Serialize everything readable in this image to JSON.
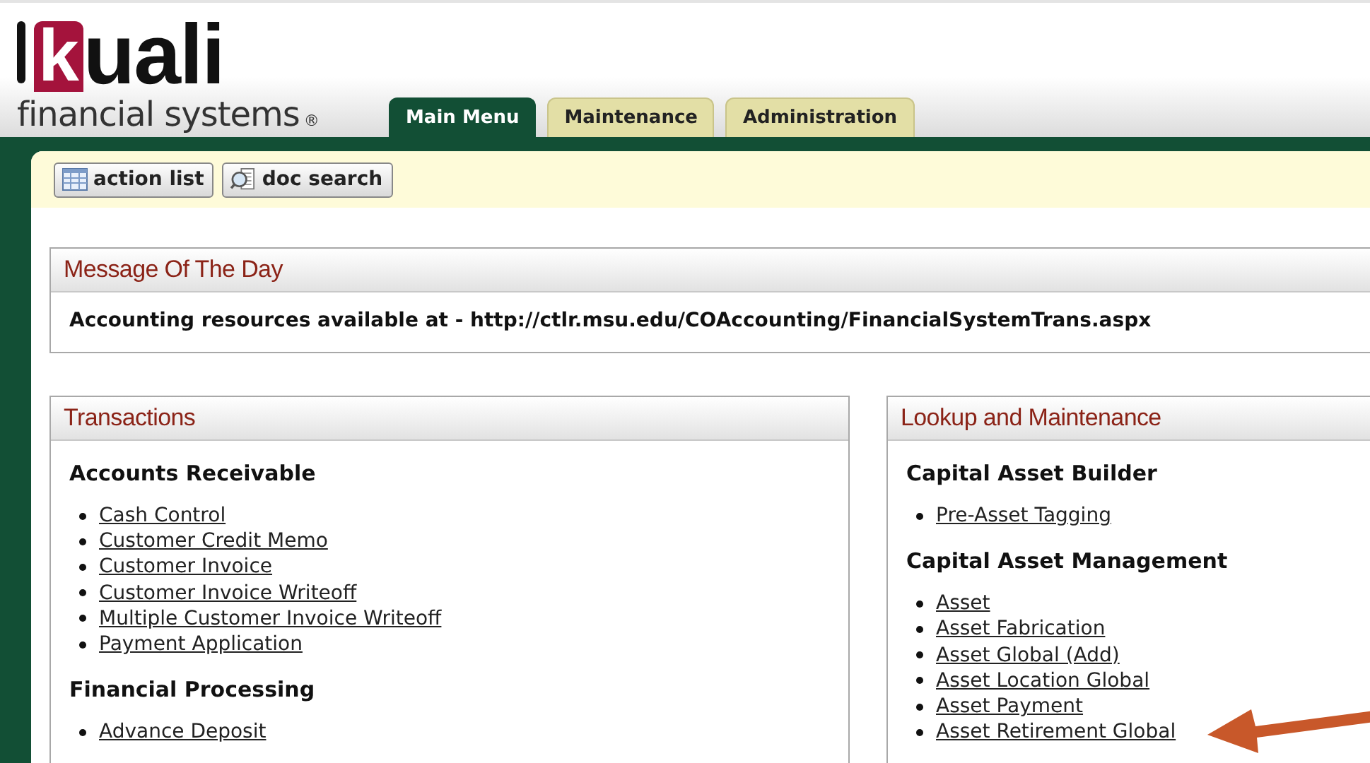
{
  "logo": {
    "mark": "k",
    "word": "uali",
    "tagline": "financial systems",
    "registered": "®"
  },
  "tabs": [
    {
      "label": "Main Menu",
      "selected": true
    },
    {
      "label": "Maintenance",
      "selected": false
    },
    {
      "label": "Administration",
      "selected": false
    }
  ],
  "toolbar": [
    {
      "label": "action list",
      "kind": "list"
    },
    {
      "label": "doc search",
      "kind": "search"
    }
  ],
  "message_of_the_day": {
    "title": "Message Of The Day",
    "text": "Accounting resources available at - http://ctlr.msu.edu/COAccounting/FinancialSystemTrans.aspx"
  },
  "panels": [
    {
      "title": "Transactions",
      "groups": [
        {
          "heading": "Accounts Receivable",
          "links": [
            "Cash Control",
            "Customer Credit Memo",
            "Customer Invoice",
            "Customer Invoice Writeoff",
            "Multiple Customer Invoice Writeoff",
            "Payment Application"
          ]
        },
        {
          "heading": "Financial Processing",
          "links": [
            "Advance Deposit"
          ]
        }
      ]
    },
    {
      "title": "Lookup and Maintenance",
      "groups": [
        {
          "heading": "Capital Asset Builder",
          "links": [
            "Pre-Asset Tagging"
          ]
        },
        {
          "heading": "Capital Asset Management",
          "links": [
            "Asset",
            "Asset Fabrication",
            "Asset Global (Add)",
            "Asset Location Global",
            "Asset Payment",
            "Asset Retirement Global"
          ]
        }
      ]
    }
  ]
}
